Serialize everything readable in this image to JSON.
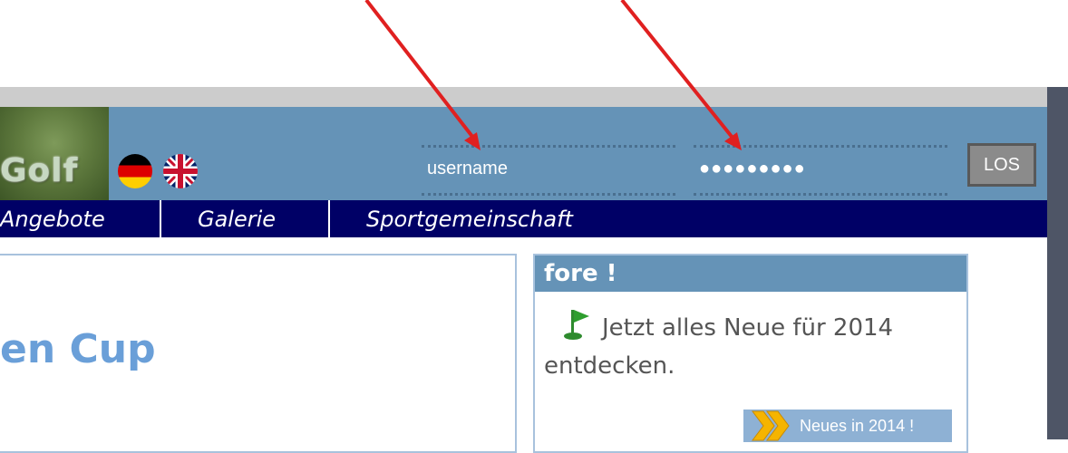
{
  "header": {
    "logo_text": "Golf",
    "languages": [
      "de",
      "en"
    ],
    "login": {
      "username_value": "username",
      "password_value": "●●●●●●●●●",
      "submit_label": "LOS"
    }
  },
  "nav": {
    "items": [
      "Angebote",
      "Galerie",
      "Sportgemeinschaft"
    ]
  },
  "main": {
    "title": "en Cup"
  },
  "sidebar": {
    "heading": "fore !",
    "text_line1": "Jetzt alles Neue für 2014",
    "text_line2": "entdecken.",
    "button_label": "Neues in 2014 !"
  },
  "colors": {
    "header": "#6593b7",
    "nav": "#000066",
    "annotation_arrow": "#e02020",
    "title_blue": "#6a9fd8"
  },
  "icons": [
    "flag-de-icon",
    "flag-uk-icon",
    "golf-flag-icon",
    "chevron-double-icon",
    "annotation-arrow-icon"
  ]
}
